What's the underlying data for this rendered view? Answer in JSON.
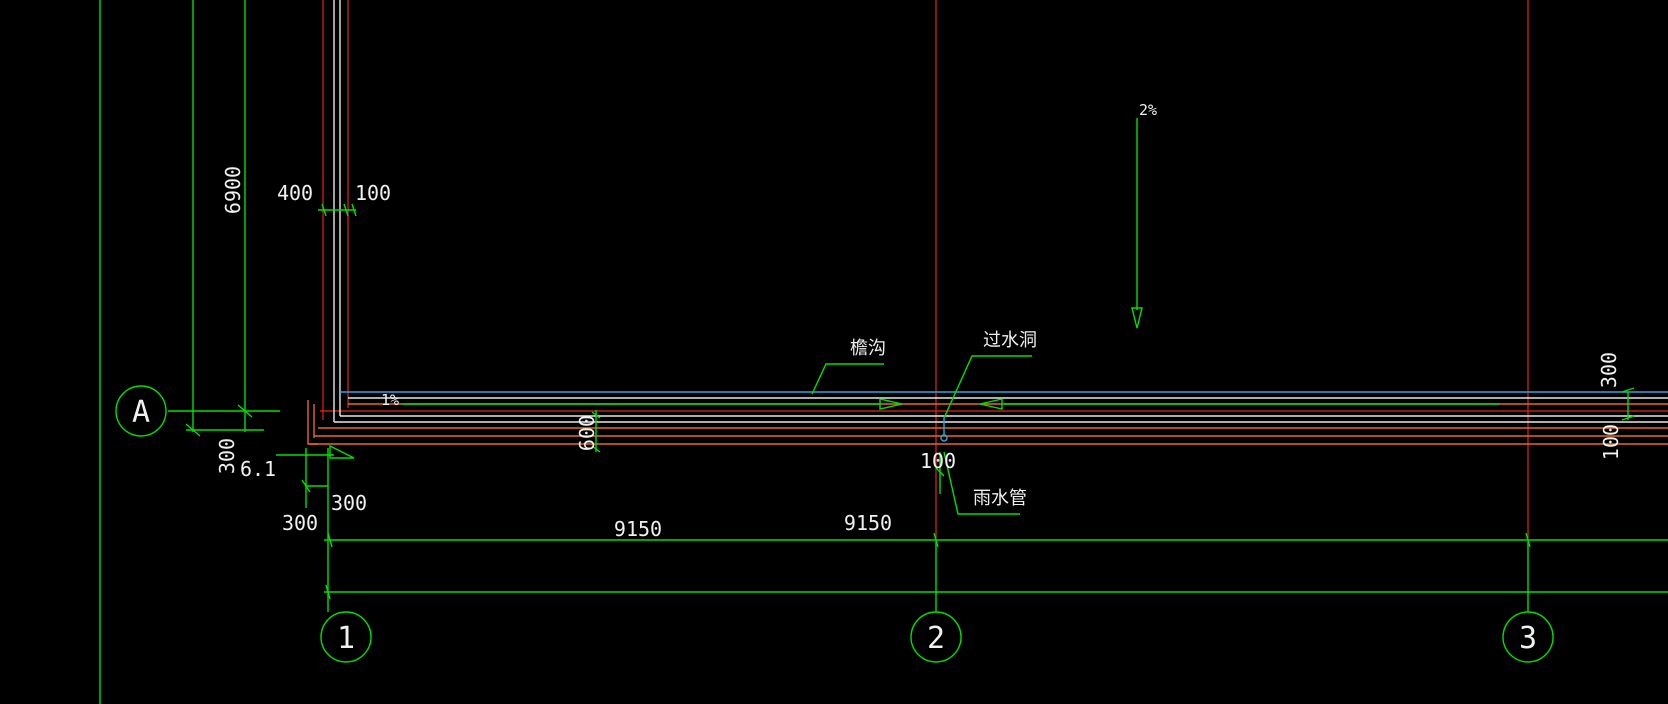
{
  "drawing": {
    "axes": {
      "row_a": "A",
      "col_1": "1",
      "col_2": "2",
      "col_3": "3"
    },
    "dimensions": {
      "d_6900": "6900",
      "d_400": "400",
      "d_100_top": "100",
      "d_300_left_vertical": "300",
      "d_61": "6.1",
      "d_300_bottom_left": "300",
      "d_300_bottom_right": "300",
      "d_9150_a": "9150",
      "d_9150_b": "9150",
      "d_600": "600",
      "d_100_pipe": "100",
      "d_300_right": "300",
      "d_100_right": "100"
    },
    "slopes": {
      "gutter_slope": "1%",
      "roof_slope": "2%"
    },
    "labels": {
      "gutter": "檐沟",
      "overflow_hole": "过水洞",
      "rain_pipe": "雨水管"
    },
    "colors": {
      "axis_line": "#e0241c",
      "dimension_line": "#00e000",
      "wall_white": "#e8e8e8",
      "gutter_orange": "#e86a1c",
      "gutter_edge_cyan": "#2aa5e0",
      "background": "#000000"
    }
  }
}
